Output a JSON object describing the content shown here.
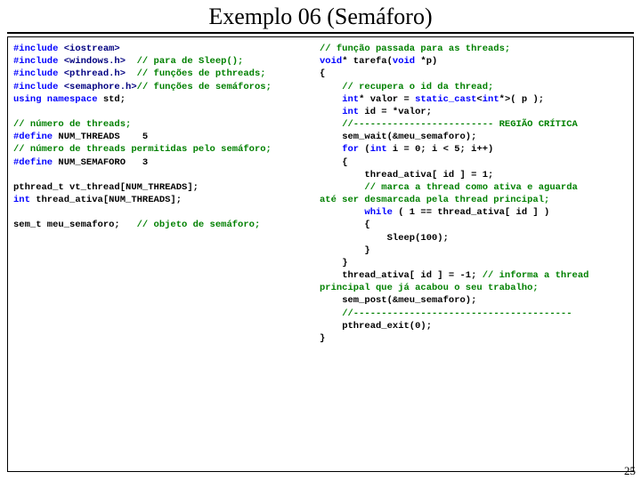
{
  "title": "Exemplo 06 (Semáforo)",
  "slide_number": "25",
  "left": {
    "l1a": "#include ",
    "l1b": "<iostream>",
    "l2a": "#include ",
    "l2b": "<windows.h>",
    "l2c": "  // para de Sleep();",
    "l3a": "#include ",
    "l3b": "<pthread.h>",
    "l3c": "  // funções de pthreads;",
    "l4a": "#include ",
    "l4b": "<semaphore.h>",
    "l4c": "// funções de semáforos;",
    "l5a": "using namespace ",
    "l5b": "std;",
    "c1": "// número de threads;",
    "d1a": "#define ",
    "d1b": "NUM_THREADS    5",
    "c2": "// número de threads permitidas pelo semáforo;",
    "d2a": "#define ",
    "d2b": "NUM_SEMAFORO   3",
    "t1": "pthread_t vt_thread[NUM_THREADS];",
    "t2a": "int",
    "t2b": " thread_ativa[NUM_THREADS];",
    "s1a": "sem_t meu_semaforo;   ",
    "s1b": "// objeto de semáforo;"
  },
  "right": {
    "c0": "// função passada para as threads;",
    "f1a": "void",
    "f1b": "* tarefa(",
    "f1c": "void",
    "f1d": " *p)",
    "br": "{",
    "c1": "    // recupera o id da thread;",
    "v1a": "    int",
    "v1b": "* valor = ",
    "v1c": "static_cast",
    "v1d": "<",
    "v1e": "int",
    "v1f": "*>( p );",
    "v2a": "    int",
    "v2b": " id = *valor;",
    "c2": "    //------------------------- REGIÃO CRÍTICA",
    "s1": "    sem_wait(&meu_semaforo);",
    "f2a": "    for ",
    "f2b": "(",
    "f2c": "int",
    "f2d": " i = 0; i < 5; i++)",
    "br2": "    {",
    "a1": "        thread_ativa[ id ] = 1;",
    "c3": "        // marca a thread como ativa e aguarda\naté ser desmarcada pela thread principal;",
    "w1a": "        while ",
    "w1b": "( 1 == thread_ativa[ id ] )",
    "br3": "        {",
    "sl": "            Sleep(100);",
    "br3c": "        }",
    "br2c": "    }",
    "a2a": "    thread_ativa[ id ] = -1;",
    "a2b": " // informa a thread\nprincipal que já acabou o seu trabalho;",
    "s2": "    sem_post(&meu_semaforo);",
    "c4": "    //---------------------------------------",
    "pe": "    pthread_exit(0);",
    "brc": "}"
  }
}
